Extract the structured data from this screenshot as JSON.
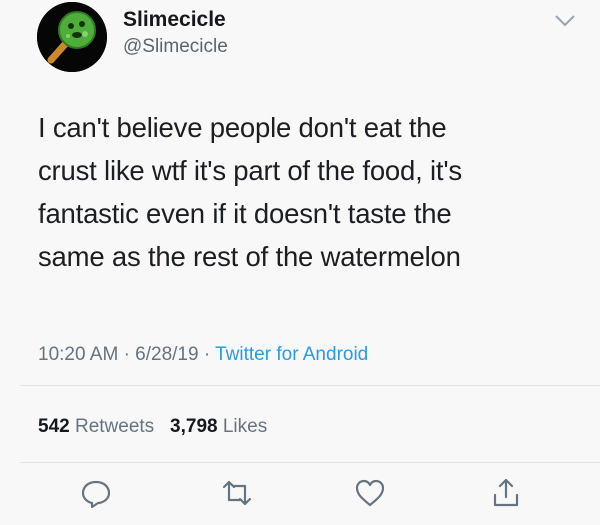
{
  "user": {
    "display_name": "Slimecicle",
    "handle": "@Slimecicle"
  },
  "tweet": {
    "lines": [
      "I can't believe people don't eat the",
      "crust like wtf it's part of the food, it's",
      "fantastic even if it doesn't taste the",
      "same as the rest of the watermelon"
    ],
    "time": "10:20 AM",
    "date": "6/28/19",
    "separator": "·",
    "source": "Twitter for Android"
  },
  "stats": {
    "retweets_count": "542",
    "retweets_label": "Retweets",
    "likes_count": "3,798",
    "likes_label": "Likes"
  },
  "icons": {
    "avatar": "slime-on-stick-avatar",
    "menu": "chevron-down-icon",
    "reply": "reply-icon",
    "retweet": "retweet-icon",
    "like": "heart-icon",
    "share": "share-icon"
  },
  "colors": {
    "link": "#2b9ae8",
    "secondary_text": "#667380",
    "background": "#f8f8f8"
  }
}
